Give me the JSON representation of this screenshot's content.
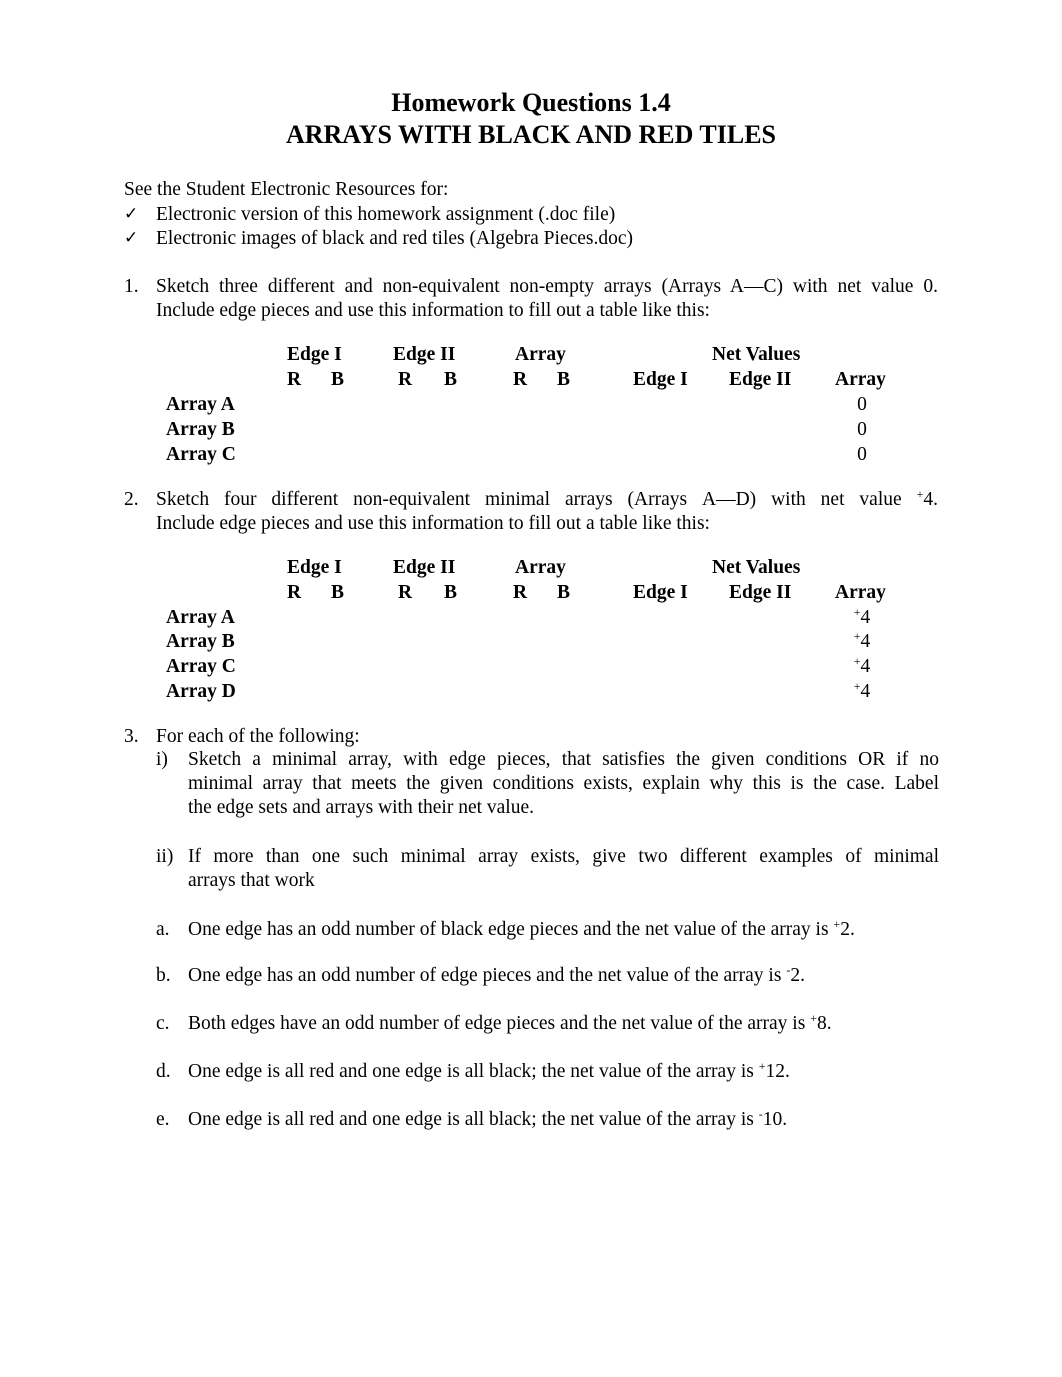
{
  "header": {
    "title": "Homework Questions 1.4",
    "subtitle": "ARRAYS WITH BLACK AND RED TILES"
  },
  "resources": {
    "intro": "See the Student Electronic Resources for:",
    "bullet_icon": "check-mark-icon",
    "bullet_glyph": "✓",
    "items": [
      "Electronic version of this homework assignment (.doc file)",
      "Electronic images of black and red tiles (Algebra Pieces.doc)"
    ]
  },
  "q1": {
    "number": "1.",
    "line1": "Sketch three different and non-equivalent non-empty arrays (Arrays A—C) with net value 0.",
    "line2": "Include edge pieces and use this information to fill out a table like this:",
    "table": {
      "group_headers": [
        "Edge I",
        "Edge II",
        "Array",
        "Net Values"
      ],
      "sub_headers": [
        "R",
        "B",
        "R",
        "B",
        "R",
        "B",
        "Edge I",
        "Edge II",
        "Array"
      ],
      "rows": [
        {
          "label": "Array A",
          "array_sign": "",
          "array_value": "0"
        },
        {
          "label": "Array B",
          "array_sign": "",
          "array_value": "0"
        },
        {
          "label": "Array C",
          "array_sign": "",
          "array_value": "0"
        }
      ]
    }
  },
  "q2": {
    "number": "2.",
    "line1_words": [
      "Sketch",
      "four",
      "different",
      "non-equivalent",
      "minimal",
      "arrays",
      "(Arrays",
      "A—D)",
      "with",
      "net",
      "value"
    ],
    "line1_sign": "+",
    "line1_end": "4.",
    "line2": "Include edge pieces and use this information to fill out a table like this:",
    "table": {
      "group_headers": [
        "Edge I",
        "Edge II",
        "Array",
        "Net Values"
      ],
      "sub_headers": [
        "R",
        "B",
        "R",
        "B",
        "R",
        "B",
        "Edge I",
        "Edge II",
        "Array"
      ],
      "rows": [
        {
          "label": "Array A",
          "array_sign": "+",
          "array_value": "4"
        },
        {
          "label": "Array B",
          "array_sign": "+",
          "array_value": "4"
        },
        {
          "label": "Array C",
          "array_sign": "+",
          "array_value": "4"
        },
        {
          "label": "Array D",
          "array_sign": "+",
          "array_value": "4"
        }
      ]
    }
  },
  "q3": {
    "number": "3.",
    "intro": "For each of the following:",
    "instructions": [
      {
        "marker": "i)",
        "lines": [
          "Sketch a minimal array, with edge pieces, that satisfies the given conditions OR if no",
          "minimal array that meets the given conditions exists, explain why this is the case. Label",
          "the edge sets and arrays with their net value."
        ]
      },
      {
        "marker": "ii)",
        "lines": [
          "If more than one such minimal array exists, give two different examples of minimal",
          "arrays that work"
        ]
      }
    ],
    "parts": [
      {
        "marker": "a.",
        "text": "One edge has an odd number of black edge pieces and the net value of the array is ",
        "sign": "+",
        "value": "2."
      },
      {
        "marker": "b.",
        "text": "One edge has an odd number of edge pieces and the net value of the array is ",
        "sign": "-",
        "value": "2."
      },
      {
        "marker": "c.",
        "text": "Both edges have an odd number of edge pieces and the net value of the array is ",
        "sign": "+",
        "value": "8."
      },
      {
        "marker": "d.",
        "text": "One edge is all red and one edge is all black; the net value of the array is ",
        "sign": "+",
        "value": "12."
      },
      {
        "marker": "e.",
        "text": "One edge is all red and one edge is all black; the net value of the array is ",
        "sign": "-",
        "value": "10."
      }
    ]
  }
}
